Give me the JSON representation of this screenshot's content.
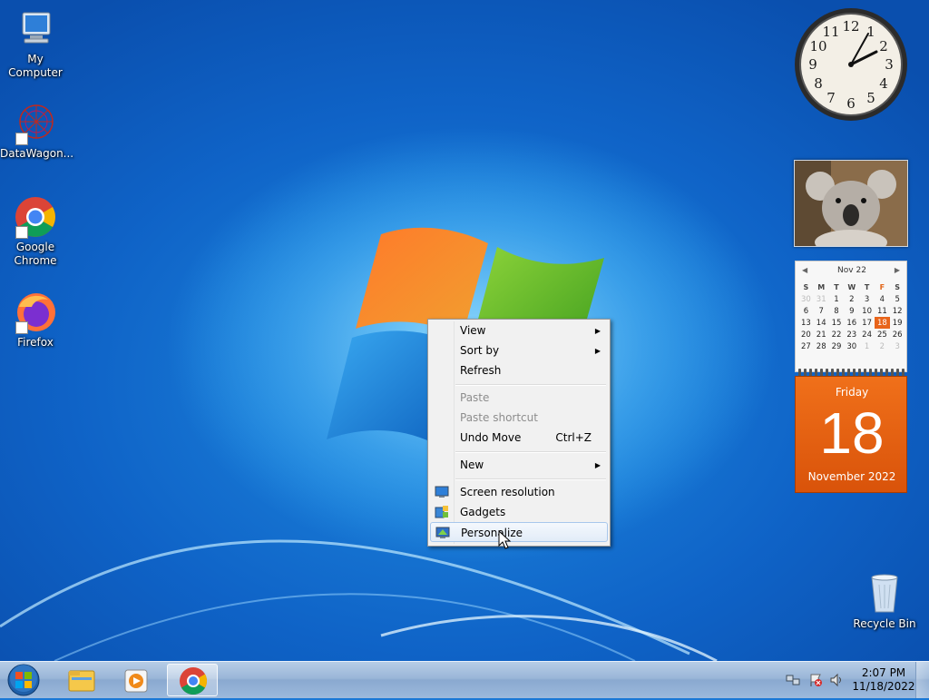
{
  "desktop_icons": [
    {
      "name": "my-computer",
      "label": "My Computer",
      "icon": "computer-icon"
    },
    {
      "name": "datawagon",
      "label": "DataWagon...",
      "icon": "datawagon-icon"
    },
    {
      "name": "google-chrome",
      "label": "Google Chrome",
      "icon": "chrome-icon"
    },
    {
      "name": "firefox",
      "label": "Firefox",
      "icon": "firefox-icon"
    },
    {
      "name": "recycle-bin",
      "label": "Recycle Bin",
      "icon": "recycle-bin-icon"
    }
  ],
  "context_menu": {
    "items": [
      {
        "label": "View",
        "submenu": true
      },
      {
        "label": "Sort by",
        "submenu": true
      },
      {
        "label": "Refresh"
      },
      {
        "label": "Paste",
        "disabled": true
      },
      {
        "label": "Paste shortcut",
        "disabled": true
      },
      {
        "label": "Undo Move",
        "shortcut": "Ctrl+Z"
      },
      {
        "label": "New",
        "submenu": true
      },
      {
        "label": "Screen resolution",
        "icon": "monitor-icon"
      },
      {
        "label": "Gadgets",
        "icon": "gadgets-icon"
      },
      {
        "label": "Personalize",
        "icon": "personalize-icon",
        "highlighted": true
      }
    ]
  },
  "clock_gadget": {
    "numbers": [
      "12",
      "1",
      "2",
      "3",
      "4",
      "5",
      "6",
      "7",
      "8",
      "9",
      "10",
      "11"
    ]
  },
  "calendar_gadget": {
    "month_header": "Nov 22",
    "weekdays": [
      "S",
      "M",
      "T",
      "W",
      "T",
      "F",
      "S"
    ],
    "weeks": [
      [
        "30",
        "31",
        "1",
        "2",
        "3",
        "4",
        "5"
      ],
      [
        "6",
        "7",
        "8",
        "9",
        "10",
        "11",
        "12"
      ],
      [
        "13",
        "14",
        "15",
        "16",
        "17",
        "18",
        "19"
      ],
      [
        "20",
        "21",
        "22",
        "23",
        "24",
        "25",
        "26"
      ],
      [
        "27",
        "28",
        "29",
        "30",
        "1",
        "2",
        "3"
      ]
    ],
    "today": "18",
    "weekday_name": "Friday",
    "day_number": "18",
    "month_year": "November 2022"
  },
  "taskbar": {
    "time": "2:07 PM",
    "date": "11/18/2022",
    "pinned": [
      "explorer-icon",
      "media-player-icon",
      "chrome-icon"
    ]
  },
  "colors": {
    "accent_orange": "#e8641a",
    "menu_bg": "#f1f1f1",
    "desktop_blue": "#1a78d6"
  }
}
